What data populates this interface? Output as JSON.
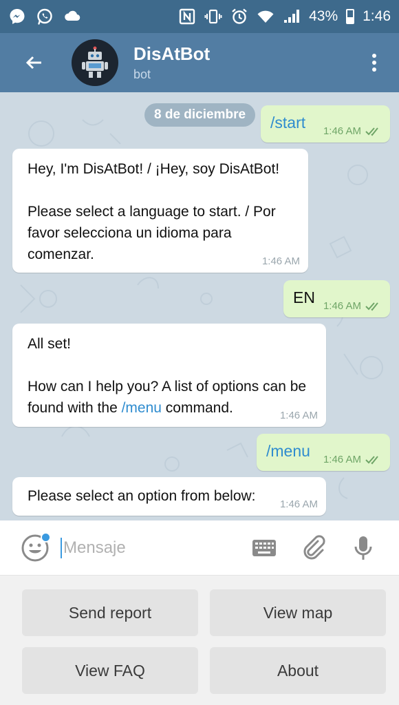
{
  "status_bar": {
    "battery": "43%",
    "time": "1:46",
    "icons": [
      "messenger-icon",
      "whatsapp-icon",
      "cloud-icon",
      "nfc-icon",
      "vibrate-icon",
      "alarm-icon",
      "wifi-icon",
      "signal-icon",
      "battery-icon"
    ]
  },
  "header": {
    "title": "DisAtBot",
    "subtitle": "bot",
    "colors": {
      "app_bar": "#527da3",
      "status_bar": "#3e6a8c"
    }
  },
  "chat": {
    "date": "8 de diciembre",
    "messages": [
      {
        "direction": "out",
        "text": "/start",
        "time": "1:46 AM",
        "read": true
      },
      {
        "direction": "in",
        "text": "Hey, I'm DisAtBot! / ¡Hey, soy DisAtBot!\n\nPlease select a language to start. / Por favor selecciona un idioma para comenzar.",
        "time": "1:46 AM"
      },
      {
        "direction": "out",
        "text": "EN",
        "time": "1:46 AM",
        "read": true
      },
      {
        "direction": "in",
        "text_before": "All set!\n\nHow can I help you? A list of options can be found with the ",
        "command": "/menu",
        "text_after": " command.",
        "time": "1:46 AM"
      },
      {
        "direction": "out",
        "text": "/menu",
        "time": "1:46 AM",
        "read": true
      },
      {
        "direction": "in",
        "text": "Please select an option from below:",
        "time": "1:46 AM"
      }
    ],
    "colors": {
      "background": "#cdd9e2",
      "outgoing": "#e1f6cb",
      "incoming": "#ffffff",
      "link": "#2f8ccf"
    }
  },
  "composer": {
    "placeholder": "Mensaje"
  },
  "keyboard": {
    "buttons": [
      "Send report",
      "View map",
      "View FAQ",
      "About"
    ]
  }
}
